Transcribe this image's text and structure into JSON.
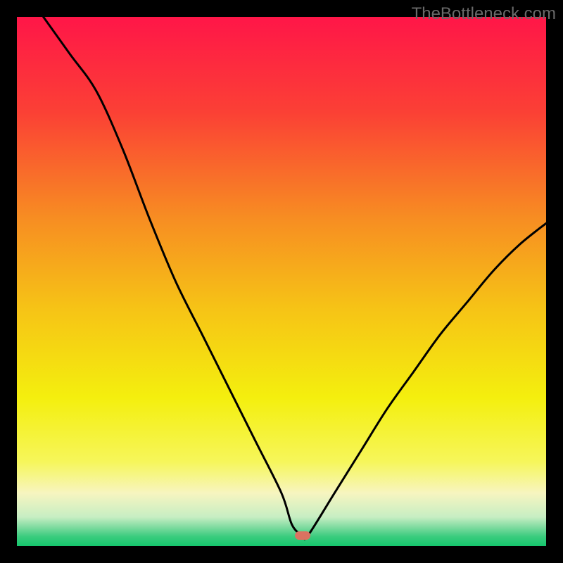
{
  "watermark": "TheBottleneck.com",
  "chart_data": {
    "type": "line",
    "title": "",
    "xlabel": "",
    "ylabel": "",
    "xlim": [
      0,
      100
    ],
    "ylim": [
      0,
      100
    ],
    "grid": false,
    "legend": false,
    "curve_minimum_x": 53,
    "marker": {
      "x": 54,
      "y": 2.0,
      "color": "#db7261"
    },
    "series": [
      {
        "name": "bottleneck-curve",
        "x": [
          5,
          10,
          15,
          20,
          25,
          30,
          35,
          40,
          45,
          50,
          52,
          54,
          55,
          60,
          65,
          70,
          75,
          80,
          85,
          90,
          95,
          100
        ],
        "y": [
          100,
          93,
          86,
          75,
          62,
          50,
          40,
          30,
          20,
          10,
          4,
          2.0,
          2.0,
          10,
          18,
          26,
          33,
          40,
          46,
          52,
          57,
          61
        ]
      }
    ],
    "background_gradient": {
      "type": "vertical",
      "stops": [
        {
          "offset": 0.0,
          "color": "#ff1648"
        },
        {
          "offset": 0.18,
          "color": "#fb4035"
        },
        {
          "offset": 0.38,
          "color": "#f78d22"
        },
        {
          "offset": 0.55,
          "color": "#f6c316"
        },
        {
          "offset": 0.72,
          "color": "#f4ef0e"
        },
        {
          "offset": 0.84,
          "color": "#f6f65a"
        },
        {
          "offset": 0.9,
          "color": "#f7f5c0"
        },
        {
          "offset": 0.945,
          "color": "#c7eec3"
        },
        {
          "offset": 0.965,
          "color": "#7cda9e"
        },
        {
          "offset": 0.982,
          "color": "#3acc7e"
        },
        {
          "offset": 1.0,
          "color": "#15c66d"
        }
      ]
    },
    "frame_color": "#000000",
    "frame_thickness_ratio": 0.03
  }
}
